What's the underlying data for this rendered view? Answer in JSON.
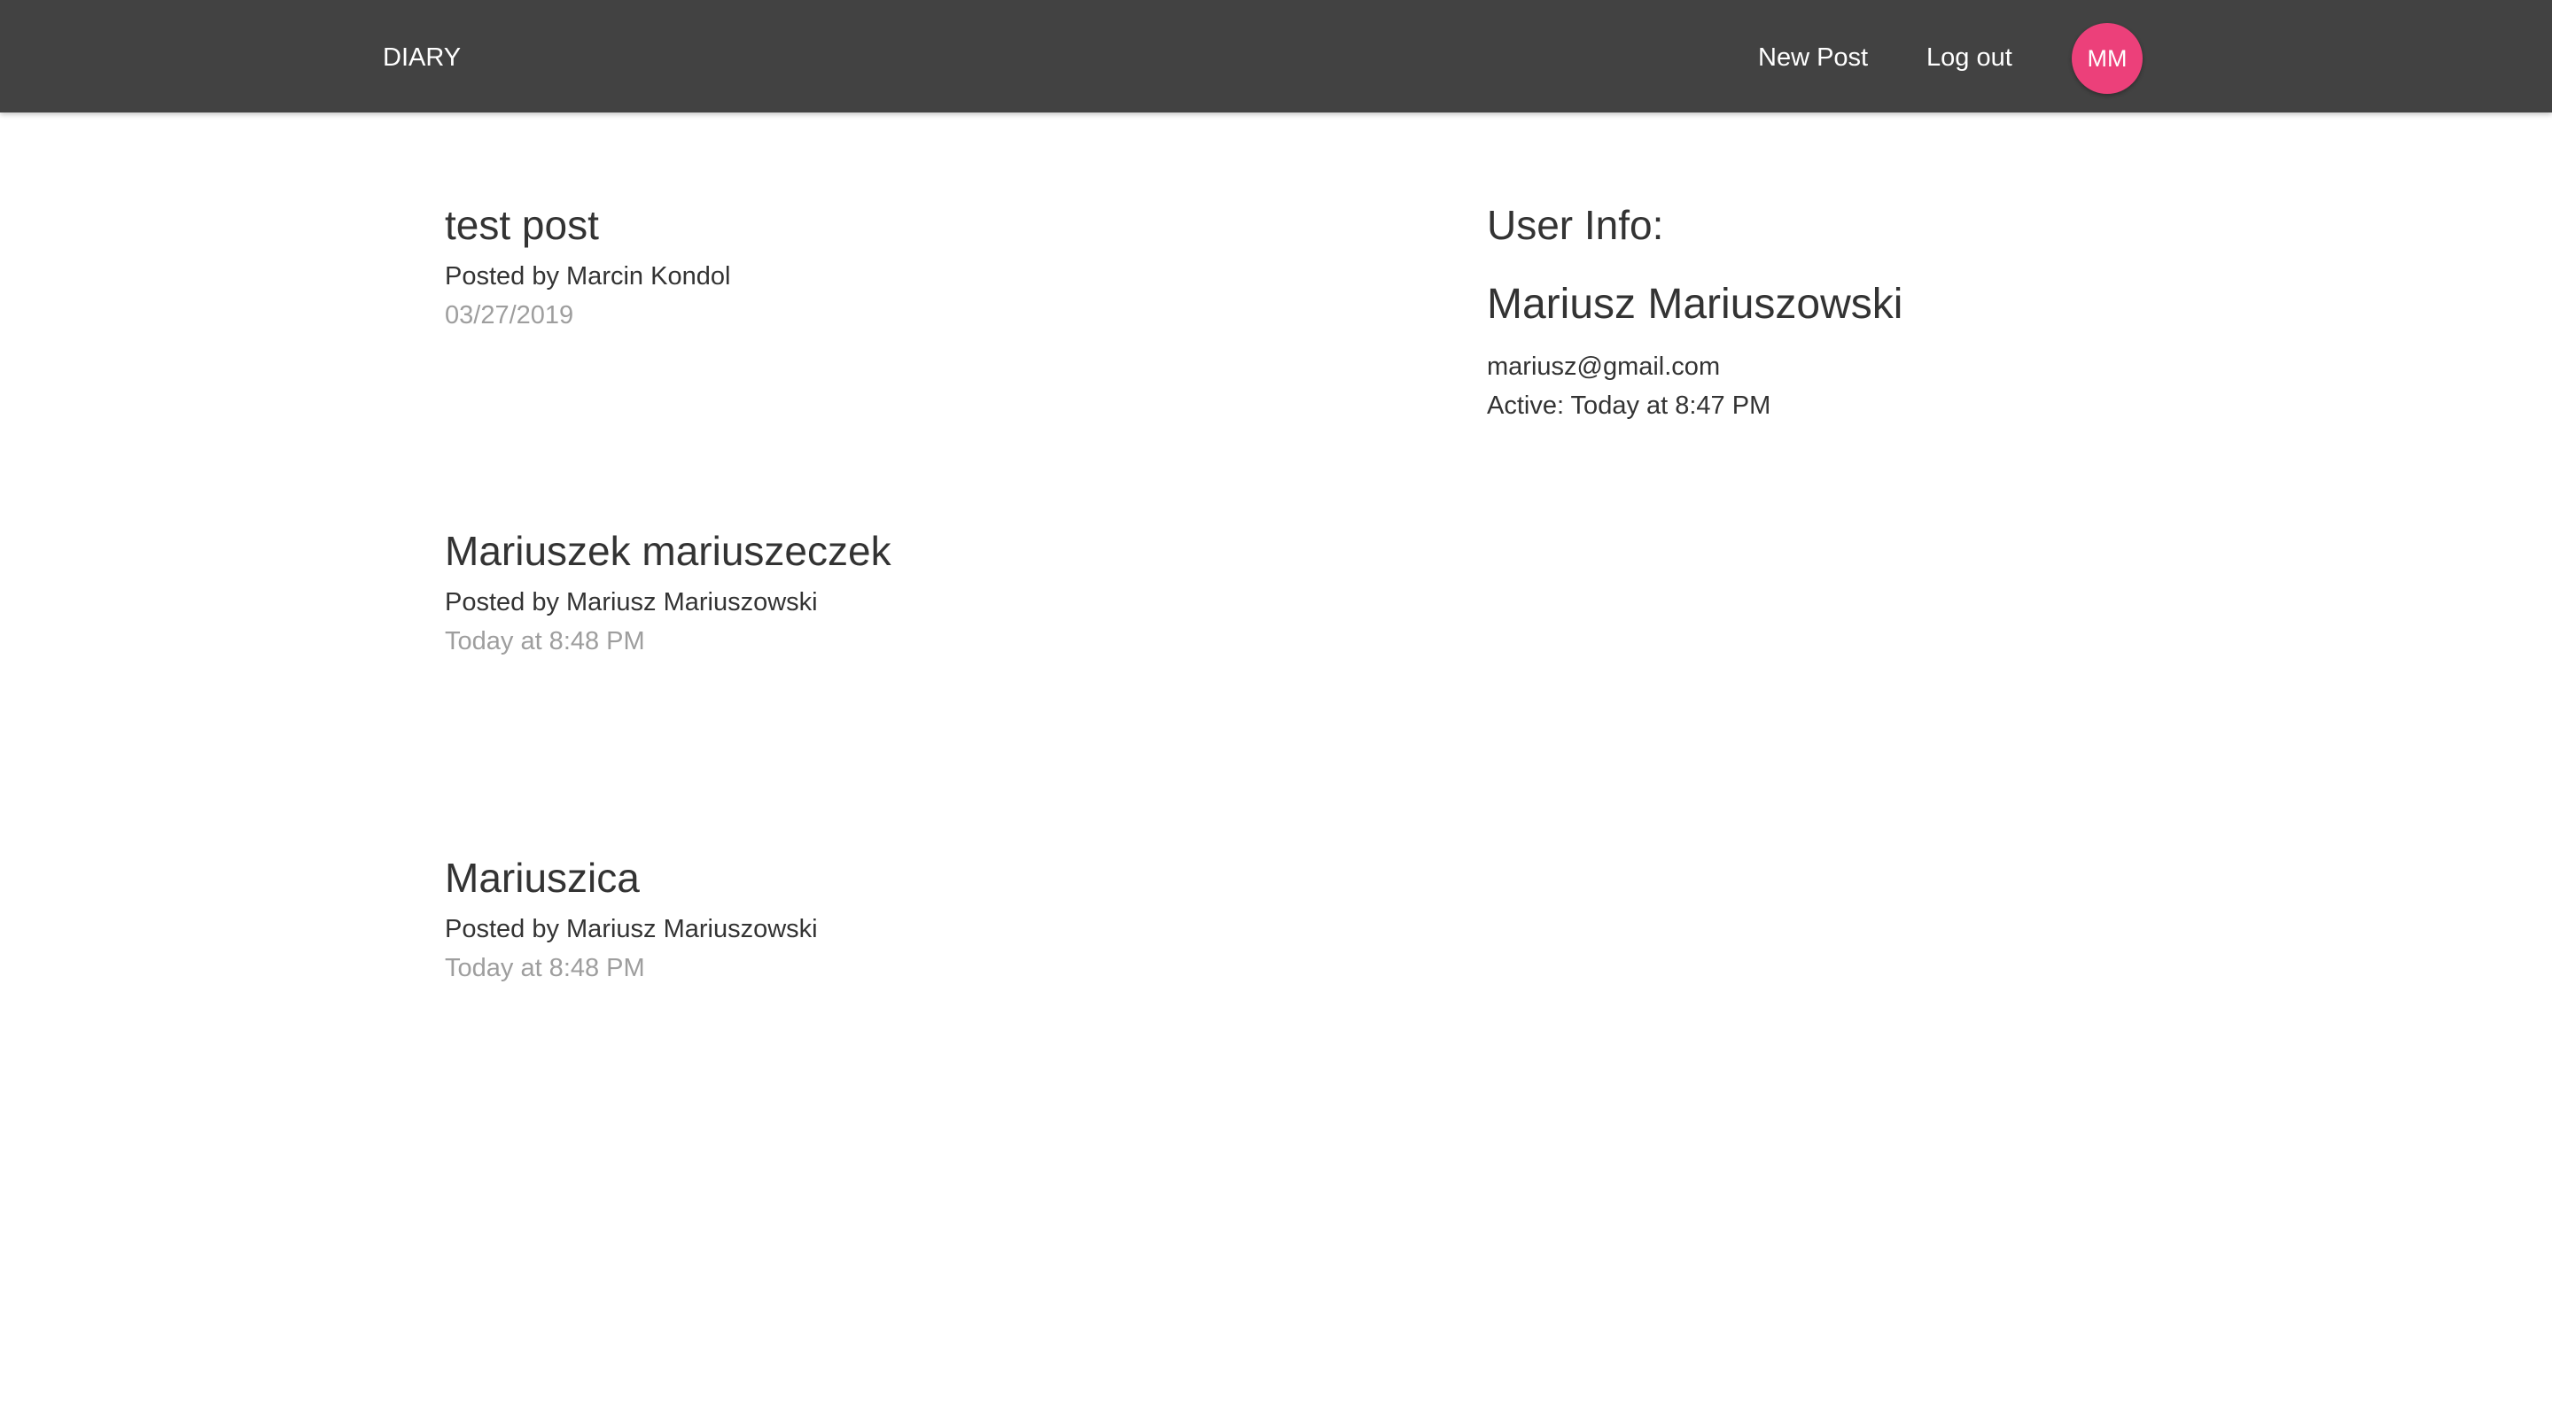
{
  "nav": {
    "brand": "DIARY",
    "new_post": "New Post",
    "logout": "Log out",
    "avatar_initials": "MM",
    "avatar_color": "#ec407a",
    "bar_color": "#424242"
  },
  "posts": [
    {
      "title": "test post",
      "author": "Posted by Marcin Kondol",
      "date": "03/27/2019"
    },
    {
      "title": "Mariuszek mariuszeczek",
      "author": "Posted by Mariusz Mariuszowski",
      "date": "Today at 8:48 PM"
    },
    {
      "title": "Mariuszica",
      "author": "Posted by Mariusz Mariuszowski",
      "date": "Today at 8:48 PM"
    }
  ],
  "user_info": {
    "heading": "User Info:",
    "name": "Mariusz Mariuszowski",
    "email": "mariusz@gmail.com",
    "active": "Active: Today at 8:47 PM"
  }
}
